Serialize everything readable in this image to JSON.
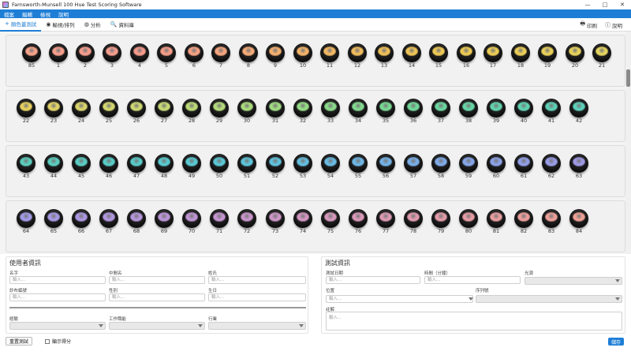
{
  "window": {
    "title": "Farnsworth-Munsell 100 Hue Test Scoring Software",
    "controls": [
      "—",
      "□",
      "✕"
    ]
  },
  "menu": [
    "檔案",
    "編輯",
    "檢視",
    "說明"
  ],
  "tabs": [
    {
      "label": "顏色蓋測試",
      "icon": "+",
      "active": true
    },
    {
      "label": "輸視/排列",
      "icon": "◉",
      "active": false
    },
    {
      "label": "分析",
      "icon": "◍",
      "active": false
    },
    {
      "label": "資料庫",
      "icon": "🔍",
      "active": false
    }
  ],
  "toolbar_right": [
    {
      "label": "印刷",
      "icon": "🖶"
    },
    {
      "label": "說明",
      "icon": "ⓘ"
    }
  ],
  "cap_rows": [
    {
      "numbers": [
        "85",
        "1",
        "2",
        "3",
        "4",
        "5",
        "6",
        "7",
        "8",
        "9",
        "10",
        "11",
        "12",
        "13",
        "14",
        "15",
        "16",
        "17",
        "18",
        "19",
        "20",
        "21"
      ],
      "colors": [
        "#f6a38a",
        "#f6a08c",
        "#f59d8e",
        "#f59d8e",
        "#f59b8c",
        "#f59e88",
        "#f6a184",
        "#f6a67e",
        "#f6ab78",
        "#f4b070",
        "#f3b46a",
        "#f2b864",
        "#f0bc5e",
        "#efc05a",
        "#eec457",
        "#edc855",
        "#ecca55",
        "#ebcc56",
        "#eace58",
        "#e8d05a",
        "#e6d25d",
        "#e4d460"
      ]
    },
    {
      "numbers": [
        "22",
        "23",
        "24",
        "25",
        "26",
        "27",
        "28",
        "29",
        "30",
        "31",
        "32",
        "33",
        "34",
        "35",
        "36",
        "37",
        "38",
        "39",
        "40",
        "41",
        "42"
      ],
      "colors": [
        "#e6d060",
        "#e0d268",
        "#dad56c",
        "#d4d770",
        "#cdd872",
        "#c6d975",
        "#bdda78",
        "#b4da7b",
        "#aadb7e",
        "#a0db82",
        "#95db86",
        "#8bda8a",
        "#82d98f",
        "#79d894",
        "#72d79a",
        "#6cd6a0",
        "#67d5a6",
        "#63d3ac",
        "#60d2b1",
        "#5ed0b6",
        "#5dcfba"
      ]
    },
    {
      "numbers": [
        "43",
        "44",
        "45",
        "46",
        "47",
        "48",
        "49",
        "50",
        "51",
        "52",
        "53",
        "54",
        "55",
        "56",
        "57",
        "58",
        "59",
        "60",
        "61",
        "62",
        "63"
      ],
      "colors": [
        "#5ccdbb",
        "#5bcdbe",
        "#5accc2",
        "#59cbc6",
        "#59cac9",
        "#59c9cd",
        "#59c8d1",
        "#5bc6d5",
        "#5dc4d9",
        "#60c1dc",
        "#64bedf",
        "#69bae2",
        "#6eb6e4",
        "#74b2e6",
        "#7aaee7",
        "#80aae8",
        "#86a6e8",
        "#8ca2e8",
        "#929fe7",
        "#989ce6",
        "#9e99e4"
      ]
    },
    {
      "numbers": [
        "64",
        "65",
        "66",
        "67",
        "68",
        "69",
        "70",
        "71",
        "72",
        "73",
        "74",
        "75",
        "76",
        "77",
        "78",
        "79",
        "80",
        "81",
        "82",
        "83",
        "84"
      ],
      "colors": [
        "#a29ae6",
        "#a799e4",
        "#ac98e2",
        "#b197df",
        "#b696dc",
        "#bb95d9",
        "#c095d5",
        "#c595d1",
        "#ca95cc",
        "#ce96c7",
        "#d297c2",
        "#d698bd",
        "#da99b8",
        "#dd9ab3",
        "#e09bae",
        "#e39ca9",
        "#e69da4",
        "#e99ea0",
        "#eb9f9c",
        "#eda099",
        "#efa196"
      ]
    }
  ],
  "user_info": {
    "title": "使用者資訊",
    "fields": [
      {
        "label": "名字",
        "placeholder": "輸入..."
      },
      {
        "label": "中間名",
        "placeholder": "輸入..."
      },
      {
        "label": "姓氏",
        "placeholder": "輸入..."
      },
      {
        "label": "診布編號",
        "placeholder": "輸入..."
      },
      {
        "label": "性別",
        "placeholder": "輸入..."
      },
      {
        "label": "生日",
        "placeholder": "輸入..."
      }
    ],
    "selects": [
      {
        "label": "經驗"
      },
      {
        "label": "工作職能"
      },
      {
        "label": "行業"
      }
    ]
  },
  "test_info": {
    "title": "測試資訊",
    "date_label": "測試日期",
    "date_placeholder": "輸入...",
    "time_label": "時間（分鐘）",
    "time_placeholder": "輸入...",
    "light_label": "光源",
    "location_label": "位置",
    "location_placeholder": "輸入...",
    "serial_label": "序列號",
    "notes_label": "註解",
    "notes_placeholder": "輸入..."
  },
  "footer": {
    "reset_label": "重置測試",
    "show_score_label": "顯示得分",
    "save_label": "儲存"
  }
}
